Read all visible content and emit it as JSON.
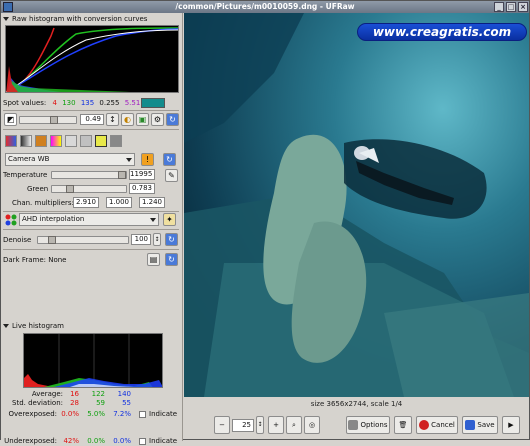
{
  "window": {
    "title": "/common/Pictures/m0010059.dng - UFRaw",
    "min_label": "_",
    "max_label": "□",
    "close_label": "×"
  },
  "raw_histogram": {
    "label": "Raw histogram with conversion curves"
  },
  "spot": {
    "label": "Spot values:",
    "r": "4",
    "g": "130",
    "b": "135",
    "v1": "0.255",
    "v2": "5.51",
    "swatch": "#138c8c"
  },
  "exposure": {
    "value": "0.49"
  },
  "wb": {
    "preset": "Camera WB",
    "warning": "!",
    "temperature_label": "Temperature",
    "temperature": "11995",
    "green_label": "Green",
    "green": "0.783",
    "chan_label": "Chan. multipliers:",
    "chan1": "2.910",
    "chan2": "1.000",
    "chan3": "1.240"
  },
  "interp": {
    "value": "AHD interpolation"
  },
  "denoise": {
    "label": "Denoise",
    "value": "100"
  },
  "darkframe": {
    "label": "Dark Frame: None"
  },
  "live_histogram": {
    "label": "Live histogram"
  },
  "stats": {
    "average_label": "Average:",
    "avg_r": "16",
    "avg_g": "122",
    "avg_b": "140",
    "std_label": "Std. deviation:",
    "std_r": "28",
    "std_g": "59",
    "std_b": "55",
    "over_label": "Overexposed:",
    "over_r": "0.0%",
    "over_g": "5.0%",
    "over_b": "7.2%",
    "under_label": "Underexposed:",
    "under_r": "42%",
    "under_g": "0.0%",
    "under_b": "0.0%",
    "indicate_label": "Indicate"
  },
  "status": {
    "text": "size 3656x2744, scale 1/4"
  },
  "bottom": {
    "zoom": "25",
    "options": "Options",
    "cancel": "Cancel",
    "save": "Save"
  },
  "watermark": {
    "text": "www.creagratis.com"
  },
  "colors": {
    "red": "#e01010",
    "green": "#10b010",
    "blue": "#1030e0"
  }
}
